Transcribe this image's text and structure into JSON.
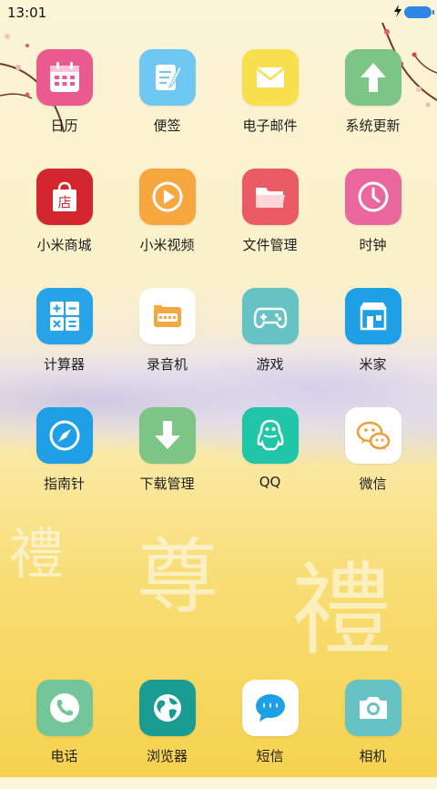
{
  "status_bar": {
    "time": "13:01"
  },
  "apps": [
    {
      "label": "日历",
      "icon": "calendar-icon",
      "color": "#e95a8f"
    },
    {
      "label": "便签",
      "icon": "notes-icon",
      "color": "#6ec8f2"
    },
    {
      "label": "电子邮件",
      "icon": "mail-icon",
      "color": "#f7df4e"
    },
    {
      "label": "系统更新",
      "icon": "update-arrow-icon",
      "color": "#7dc587"
    },
    {
      "label": "小米商城",
      "icon": "store-bag-icon",
      "color": "#d4262e",
      "glyph": "店"
    },
    {
      "label": "小米视频",
      "icon": "play-icon",
      "color": "#f6a73e"
    },
    {
      "label": "文件管理",
      "icon": "folder-icon",
      "color": "#ea5b66"
    },
    {
      "label": "时钟",
      "icon": "clock-icon",
      "color": "#e9679d"
    },
    {
      "label": "计算器",
      "icon": "calculator-icon",
      "color": "#27a3e8"
    },
    {
      "label": "录音机",
      "icon": "recorder-icon",
      "color": "#ffffff"
    },
    {
      "label": "游戏",
      "icon": "gamepad-icon",
      "color": "#67c2c4"
    },
    {
      "label": "米家",
      "icon": "home-shop-icon",
      "color": "#1fa0e6"
    },
    {
      "label": "指南针",
      "icon": "compass-icon",
      "color": "#1f9fe6"
    },
    {
      "label": "下载管理",
      "icon": "download-icon",
      "color": "#7dc587"
    },
    {
      "label": "QQ",
      "icon": "qq-penguin-icon",
      "color": "#21c5a8"
    },
    {
      "label": "微信",
      "icon": "wechat-icon",
      "color": "#ffffff"
    }
  ],
  "dock": [
    {
      "label": "电话",
      "icon": "phone-icon",
      "color": "#74c69a"
    },
    {
      "label": "浏览器",
      "icon": "globe-icon",
      "color": "#1a9c92"
    },
    {
      "label": "短信",
      "icon": "message-icon",
      "color": "#ffffff"
    },
    {
      "label": "相机",
      "icon": "camera-icon",
      "color": "#67c2c4"
    }
  ]
}
